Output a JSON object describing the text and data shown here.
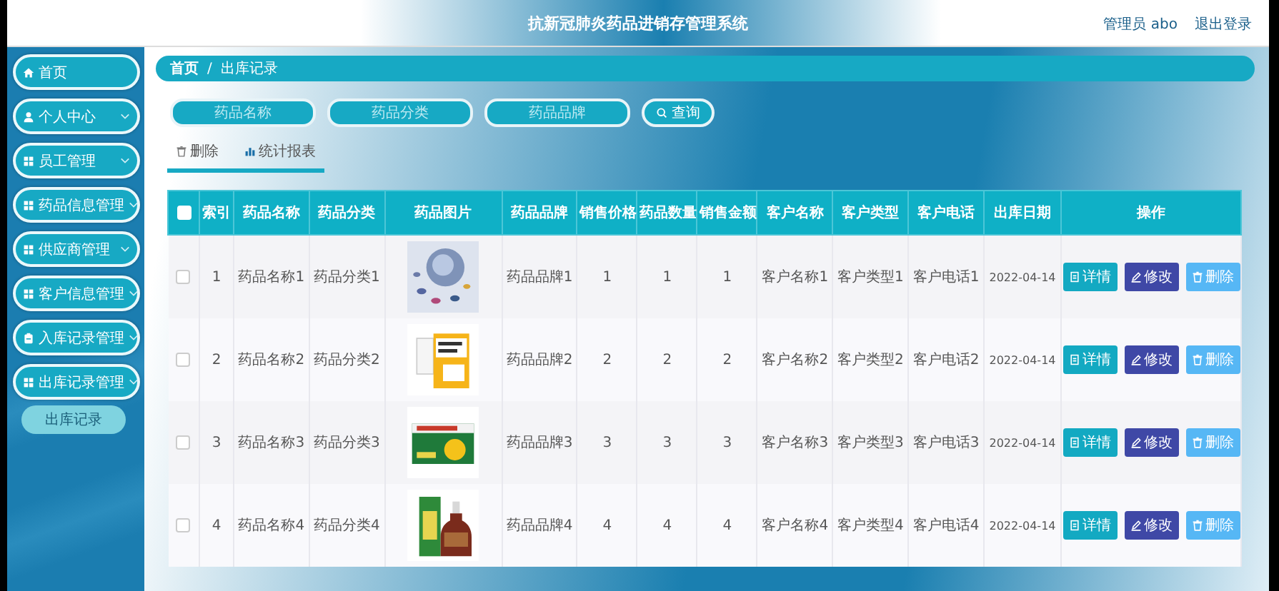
{
  "header": {
    "title": "抗新冠肺炎药品进销存管理系统",
    "user": "管理员 abo",
    "logout": "退出登录"
  },
  "sidebar": {
    "items": [
      {
        "label": "首页",
        "kind": "home",
        "expandable": false
      },
      {
        "label": "个人中心",
        "kind": "user",
        "expandable": true
      },
      {
        "label": "员工管理",
        "kind": "grid",
        "expandable": true
      },
      {
        "label": "药品信息管理",
        "kind": "grid",
        "expandable": true
      },
      {
        "label": "供应商管理",
        "kind": "grid",
        "expandable": true
      },
      {
        "label": "客户信息管理",
        "kind": "grid",
        "expandable": true
      },
      {
        "label": "入库记录管理",
        "kind": "clipboard",
        "expandable": true
      },
      {
        "label": "出库记录管理",
        "kind": "grid",
        "expandable": true,
        "children": [
          {
            "label": "出库记录"
          }
        ]
      }
    ]
  },
  "breadcrumb": {
    "items": [
      "首页",
      "出库记录"
    ],
    "separator": "/"
  },
  "search": {
    "fields": [
      {
        "placeholder": "药品名称"
      },
      {
        "placeholder": "药品分类"
      },
      {
        "placeholder": "药品品牌"
      }
    ],
    "button": "查询"
  },
  "toolbar": [
    {
      "label": "删除",
      "kind": "delete"
    },
    {
      "label": "统计报表",
      "kind": "report"
    }
  ],
  "table": {
    "all_checked": false,
    "columns": [
      "索引",
      "药品名称",
      "药品分类",
      "药品图片",
      "药品品牌",
      "销售价格",
      "药品数量",
      "销售金额",
      "客户名称",
      "客户类型",
      "客户电话",
      "出库日期",
      "操作"
    ],
    "rows": [
      {
        "checked": false,
        "index": "1",
        "name": "药品名称1",
        "category": "药品分类1",
        "image": {
          "kind": "picture"
        },
        "brand": "药品品牌1",
        "price": "1",
        "quantity": "1",
        "amount": "1",
        "customer": "客户名称1",
        "customer_type": "客户类型1",
        "phone": "客户电话1",
        "date": "2022-04-14",
        "actions": [
          {
            "label": "详情",
            "kind": "detail"
          },
          {
            "label": "修改",
            "kind": "edit"
          },
          {
            "label": "删除",
            "kind": "delete"
          }
        ]
      },
      {
        "checked": false,
        "index": "2",
        "name": "药品名称2",
        "category": "药品分类2",
        "image": {
          "kind": "picture"
        },
        "brand": "药品品牌2",
        "price": "2",
        "quantity": "2",
        "amount": "2",
        "customer": "客户名称2",
        "customer_type": "客户类型2",
        "phone": "客户电话2",
        "date": "2022-04-14",
        "actions": [
          {
            "label": "详情",
            "kind": "detail"
          },
          {
            "label": "修改",
            "kind": "edit"
          },
          {
            "label": "删除",
            "kind": "delete"
          }
        ]
      },
      {
        "checked": false,
        "index": "3",
        "name": "药品名称3",
        "category": "药品分类3",
        "image": {
          "kind": "picture"
        },
        "brand": "药品品牌3",
        "price": "3",
        "quantity": "3",
        "amount": "3",
        "customer": "客户名称3",
        "customer_type": "客户类型3",
        "phone": "客户电话3",
        "date": "2022-04-14",
        "actions": [
          {
            "label": "详情",
            "kind": "detail"
          },
          {
            "label": "修改",
            "kind": "edit"
          },
          {
            "label": "删除",
            "kind": "delete"
          }
        ]
      },
      {
        "checked": false,
        "index": "4",
        "name": "药品名称4",
        "category": "药品分类4",
        "image": {
          "kind": "picture"
        },
        "brand": "药品品牌4",
        "price": "4",
        "quantity": "4",
        "amount": "4",
        "customer": "客户名称4",
        "customer_type": "客户类型4",
        "phone": "客户电话4",
        "date": "2022-04-14",
        "actions": [
          {
            "label": "详情",
            "kind": "detail"
          },
          {
            "label": "修改",
            "kind": "edit"
          },
          {
            "label": "删除",
            "kind": "delete"
          }
        ]
      }
    ]
  }
}
